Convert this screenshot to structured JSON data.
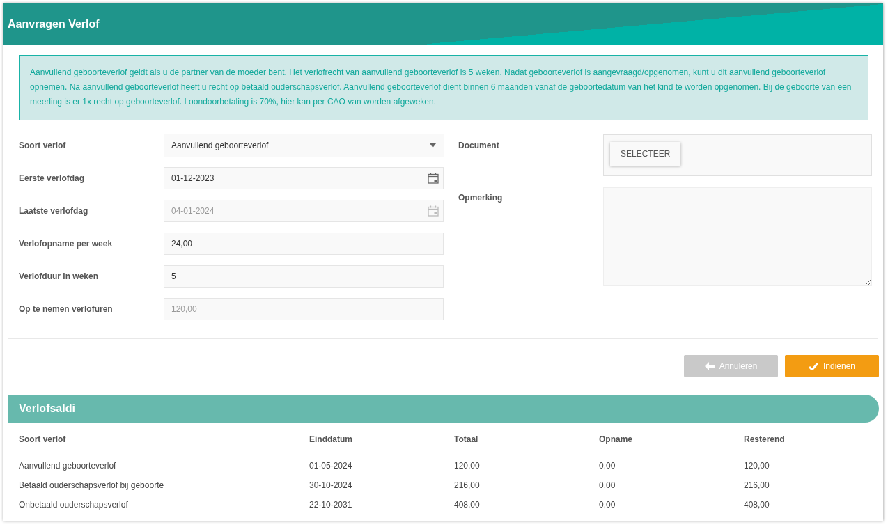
{
  "header": {
    "title": "Aanvragen Verlof"
  },
  "info": "Aanvullend geboorteverlof geldt als u de partner van de moeder bent. Het verlofrecht van aanvullend geboorteverlof is 5 weken. Nadat geboorteverlof is aangevraagd/opgenomen, kunt u dit aanvullend geboorteverlof opnemen. Na aanvullend geboorteverlof heeft u recht op betaald ouderschapsverlof. Aanvullend geboorteverlof dient binnen 6 maanden vanaf de geboortedatum van het kind te worden opgenomen. Bij de geboorte van een meerling is er 1x recht op geboorteverlof. Loondoorbetaling is 70%, hier kan per CAO van worden afgeweken.",
  "left_fields": [
    {
      "label": "Soort verlof",
      "kind": "select",
      "value": "Aanvullend geboorteverlof",
      "disabled": false
    },
    {
      "label": "Eerste verlofdag",
      "kind": "date",
      "value": "01-12-2023",
      "disabled": false
    },
    {
      "label": "Laatste verlofdag",
      "kind": "date",
      "value": "04-01-2024",
      "disabled": true
    },
    {
      "label": "Verlofopname per week",
      "kind": "text",
      "value": "24,00",
      "disabled": false
    },
    {
      "label": "Verlofduur in weken",
      "kind": "text",
      "value": "5",
      "disabled": false
    },
    {
      "label": "Op te nemen verlofuren",
      "kind": "text",
      "value": "120,00",
      "disabled": true
    }
  ],
  "right_fields": [
    {
      "label": "Document",
      "kind": "file",
      "button": "SELECTEER"
    },
    {
      "label": "Opmerking",
      "kind": "textarea"
    }
  ],
  "buttons": [
    {
      "label": "Annuleren",
      "kind": "back",
      "disabled": true
    },
    {
      "label": "Indienen",
      "kind": "submit",
      "disabled": false
    }
  ],
  "balances": {
    "title": "Verlofsaldi",
    "columns": [
      "Soort verlof",
      "Einddatum",
      "Totaal",
      "Opname",
      "Resterend"
    ],
    "rows": [
      [
        "Aanvullend geboorteverlof",
        "01-05-2024",
        "120,00",
        "0,00",
        "120,00"
      ],
      [
        "Betaald ouderschapsverlof bij geboorte",
        "30-10-2024",
        "216,00",
        "0,00",
        "216,00"
      ],
      [
        "Onbetaald ouderschapsverlof",
        "22-10-2031",
        "408,00",
        "0,00",
        "408,00"
      ]
    ]
  }
}
